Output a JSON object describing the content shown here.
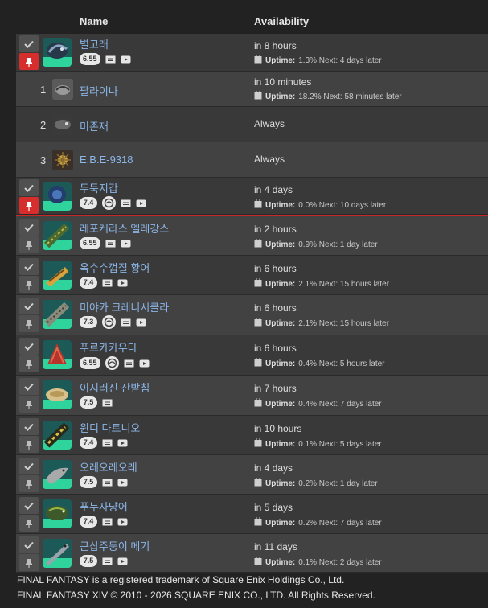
{
  "header": {
    "name_label": "Name",
    "availability_label": "Availability"
  },
  "rows": [
    {
      "name": "별고래",
      "patch": "6.55",
      "availability": "in 8 hours",
      "uptime_label": "Uptime:",
      "uptime_text": "1.3% Next: 4 days later",
      "pinned": true
    },
    {
      "index": "1",
      "name": "팔라이나",
      "availability": "in 10 minutes",
      "uptime_label": "Uptime:",
      "uptime_text": "18.2% Next: 58 minutes later"
    },
    {
      "index": "2",
      "name": "미존재",
      "availability": "Always"
    },
    {
      "index": "3",
      "name": "E.B.E-9318",
      "availability": "Always"
    },
    {
      "name": "두둑지갑",
      "patch": "7.4",
      "availability": "in 4 days",
      "uptime_label": "Uptime:",
      "uptime_text": "0.0% Next: 10 days later",
      "pinned": true
    },
    {
      "name": "레포케라스 엘레강스",
      "patch": "6.55",
      "availability": "in 2 hours",
      "uptime_label": "Uptime:",
      "uptime_text": "0.9% Next: 1 day later"
    },
    {
      "name": "옥수수껍질 황어",
      "patch": "7.4",
      "availability": "in 6 hours",
      "uptime_label": "Uptime:",
      "uptime_text": "2.1% Next: 15 hours later"
    },
    {
      "name": "미야카 크레니시클라",
      "patch": "7.3",
      "availability": "in 6 hours",
      "uptime_label": "Uptime:",
      "uptime_text": "2.1% Next: 15 hours later"
    },
    {
      "name": "푸르카카우다",
      "patch": "6.55",
      "availability": "in 6 hours",
      "uptime_label": "Uptime:",
      "uptime_text": "0.4% Next: 5 hours later"
    },
    {
      "name": "이지러진 잔받침",
      "patch": "7.5",
      "availability": "in 7 hours",
      "uptime_label": "Uptime:",
      "uptime_text": "0.4% Next: 7 days later"
    },
    {
      "name": "윈디 다트니오",
      "patch": "7.4",
      "availability": "in 10 hours",
      "uptime_label": "Uptime:",
      "uptime_text": "0.1% Next: 5 days later"
    },
    {
      "name": "오레오레오레",
      "patch": "7.5",
      "availability": "in 4 days",
      "uptime_label": "Uptime:",
      "uptime_text": "0.2% Next: 1 day later"
    },
    {
      "name": "푸누사냥어",
      "patch": "7.4",
      "availability": "in 5 days",
      "uptime_label": "Uptime:",
      "uptime_text": "0.2% Next: 7 days later"
    },
    {
      "name": "큰삽주둥이 메기",
      "patch": "7.5",
      "availability": "in 11 days",
      "uptime_label": "Uptime:",
      "uptime_text": "0.1% Next: 2 days later"
    }
  ],
  "footer": {
    "line1": "FINAL FANTASY is a registered trademark of Square Enix Holdings Co., Ltd.",
    "line2": "FINAL FANTASY XIV © 2010 - 2026 SQUARE ENIX CO., LTD. All Rights Reserved."
  },
  "colors": {
    "accent_red": "#d62d2d",
    "link_blue": "#8cb6e8",
    "row_bg": "#393939",
    "row_alt_bg": "#424242"
  }
}
